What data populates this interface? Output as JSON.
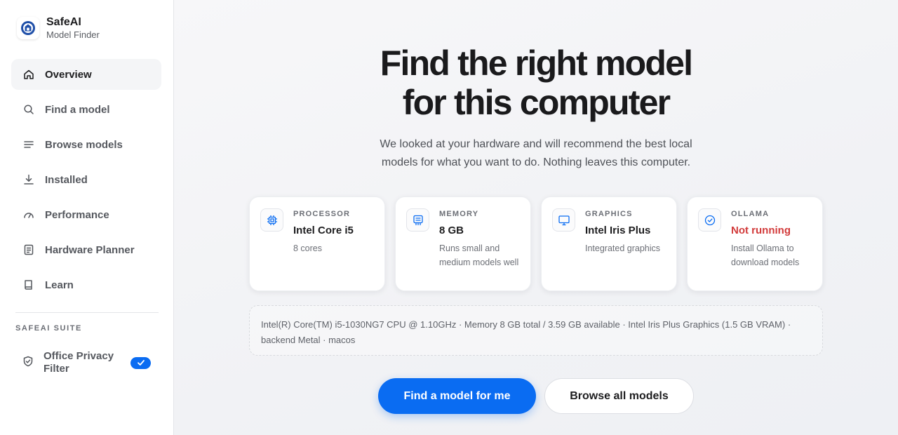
{
  "brand": {
    "name": "SafeAI",
    "subtitle": "Model Finder"
  },
  "nav": {
    "items": [
      {
        "label": "Overview",
        "icon": "home-icon",
        "active": true
      },
      {
        "label": "Find a model",
        "icon": "search-icon"
      },
      {
        "label": "Browse models",
        "icon": "list-icon"
      },
      {
        "label": "Installed",
        "icon": "download-icon"
      },
      {
        "label": "Performance",
        "icon": "gauge-icon"
      },
      {
        "label": "Hardware Planner",
        "icon": "document-icon"
      },
      {
        "label": "Learn",
        "icon": "book-icon"
      }
    ]
  },
  "suite": {
    "title": "SAFEAI SUITE",
    "items": [
      {
        "label": "Office Privacy Filter",
        "icon": "shield-icon",
        "installed": true
      }
    ]
  },
  "hero": {
    "title_line1": "Find the right model",
    "title_line2": "for this computer",
    "subtitle": "We looked at your hardware and will recommend the best local models for what you want to do. Nothing leaves this computer."
  },
  "cards": [
    {
      "label": "PROCESSOR",
      "value": "Intel Core i5",
      "desc": "8 cores",
      "icon": "cpu-icon"
    },
    {
      "label": "MEMORY",
      "value": "8 GB",
      "desc": "Runs small and medium models well",
      "icon": "memory-icon"
    },
    {
      "label": "GRAPHICS",
      "value": "Intel Iris Plus",
      "desc": "Integrated graphics",
      "icon": "monitor-icon"
    },
    {
      "label": "OLLAMA",
      "value": "Not running",
      "desc": "Install Ollama to download models",
      "icon": "check-circle-icon",
      "status_color": "#d23b3b"
    }
  ],
  "spec_line": "Intel(R) Core(TM) i5-1030NG7 CPU @ 1.10GHz · Memory 8 GB total / 3.59 GB available · Intel Iris Plus Graphics (1.5 GB VRAM) · backend Metal · macos",
  "actions": {
    "primary": "Find a model for me",
    "secondary": "Browse all models"
  },
  "colors": {
    "accent": "#0a6cf2",
    "danger": "#d23b3b"
  }
}
